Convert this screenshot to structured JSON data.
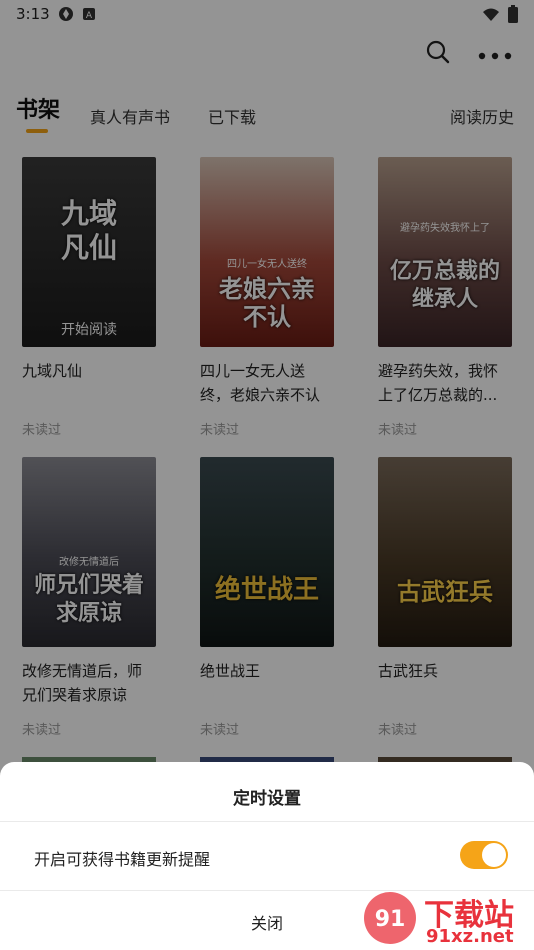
{
  "status_bar": {
    "time": "3:13",
    "left_icons": [
      "app-icon",
      "text-badge-icon"
    ],
    "right_icons": [
      "wifi-icon",
      "battery-icon"
    ]
  },
  "top_actions": {
    "icons": [
      "search-icon",
      "more-icon"
    ]
  },
  "tabs": [
    {
      "label": "书架",
      "active": true
    },
    {
      "label": "真人有声书",
      "active": false
    },
    {
      "label": "已下载",
      "active": false
    },
    {
      "label": "阅读历史",
      "active": false
    }
  ],
  "books": [
    {
      "cover_title": "九域凡仙",
      "badge": "开始阅读",
      "title": "九域凡仙",
      "status": "未读过",
      "cover_color": "#2b2b2b"
    },
    {
      "cover_title": "老娘六亲不认",
      "cover_sub": "四儿一女无人送终",
      "title": "四儿一女无人送终，老娘六亲不认",
      "status": "未读过",
      "cover_color": "#8a2a1e"
    },
    {
      "cover_title": "亿万总裁的继承人",
      "cover_sub": "避孕药失效我怀上了",
      "title": "避孕药失效，我怀上了亿万总裁的...",
      "status": "未读过",
      "cover_color": "#5a3b3a"
    },
    {
      "cover_title": "师兄们哭着求原谅",
      "cover_sub": "改修无情道后",
      "title": "改修无情道后，师兄们哭着求原谅",
      "status": "未读过",
      "cover_color": "#4a4a52"
    },
    {
      "cover_title": "绝世战王",
      "title": "绝世战王",
      "status": "未读过",
      "cover_color": "#1f2a2e"
    },
    {
      "cover_title": "古武狂兵",
      "title": "古武狂兵",
      "status": "未读过",
      "cover_color": "#3c3020"
    }
  ],
  "sheet": {
    "title": "定时设置",
    "row_label": "开启可获得书籍更新提醒",
    "toggle_on": true,
    "close_label": "关闭"
  },
  "watermark": {
    "brand": "下载站",
    "url": "91xz.net"
  },
  "colors": {
    "accent": "#f5a418",
    "dim": "rgba(0,0,0,0.42)"
  }
}
